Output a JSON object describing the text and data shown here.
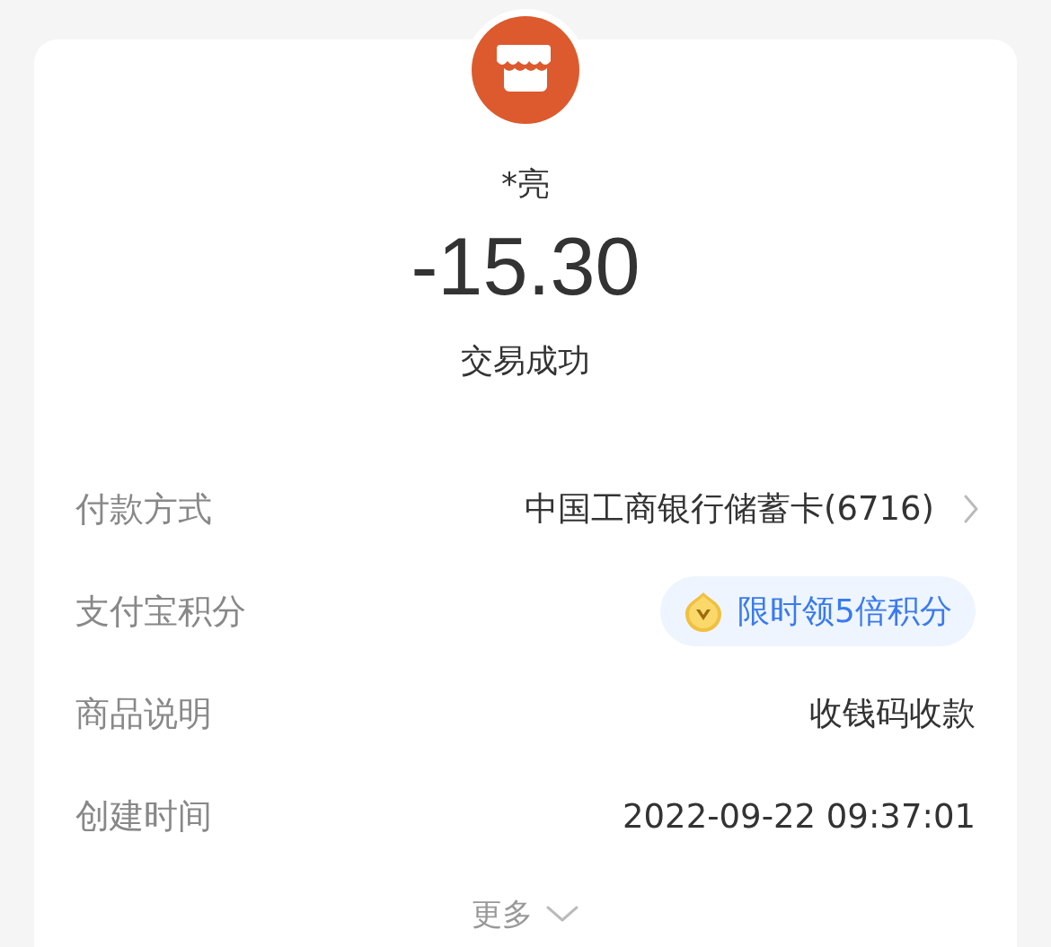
{
  "payee": {
    "name": "*亮",
    "amount": "-15.30",
    "status": "交易成功"
  },
  "rows": [
    {
      "label": "付款方式",
      "kind": "link",
      "value": "中国工商银行储蓄卡(6716)"
    },
    {
      "label": "支付宝积分",
      "kind": "badge",
      "value": "限时领5倍积分"
    },
    {
      "label": "商品说明",
      "kind": "text",
      "value": "收钱码收款"
    },
    {
      "label": "创建时间",
      "kind": "text",
      "value": "2022-09-22 09:37:01"
    }
  ],
  "more": {
    "label": "更多"
  }
}
